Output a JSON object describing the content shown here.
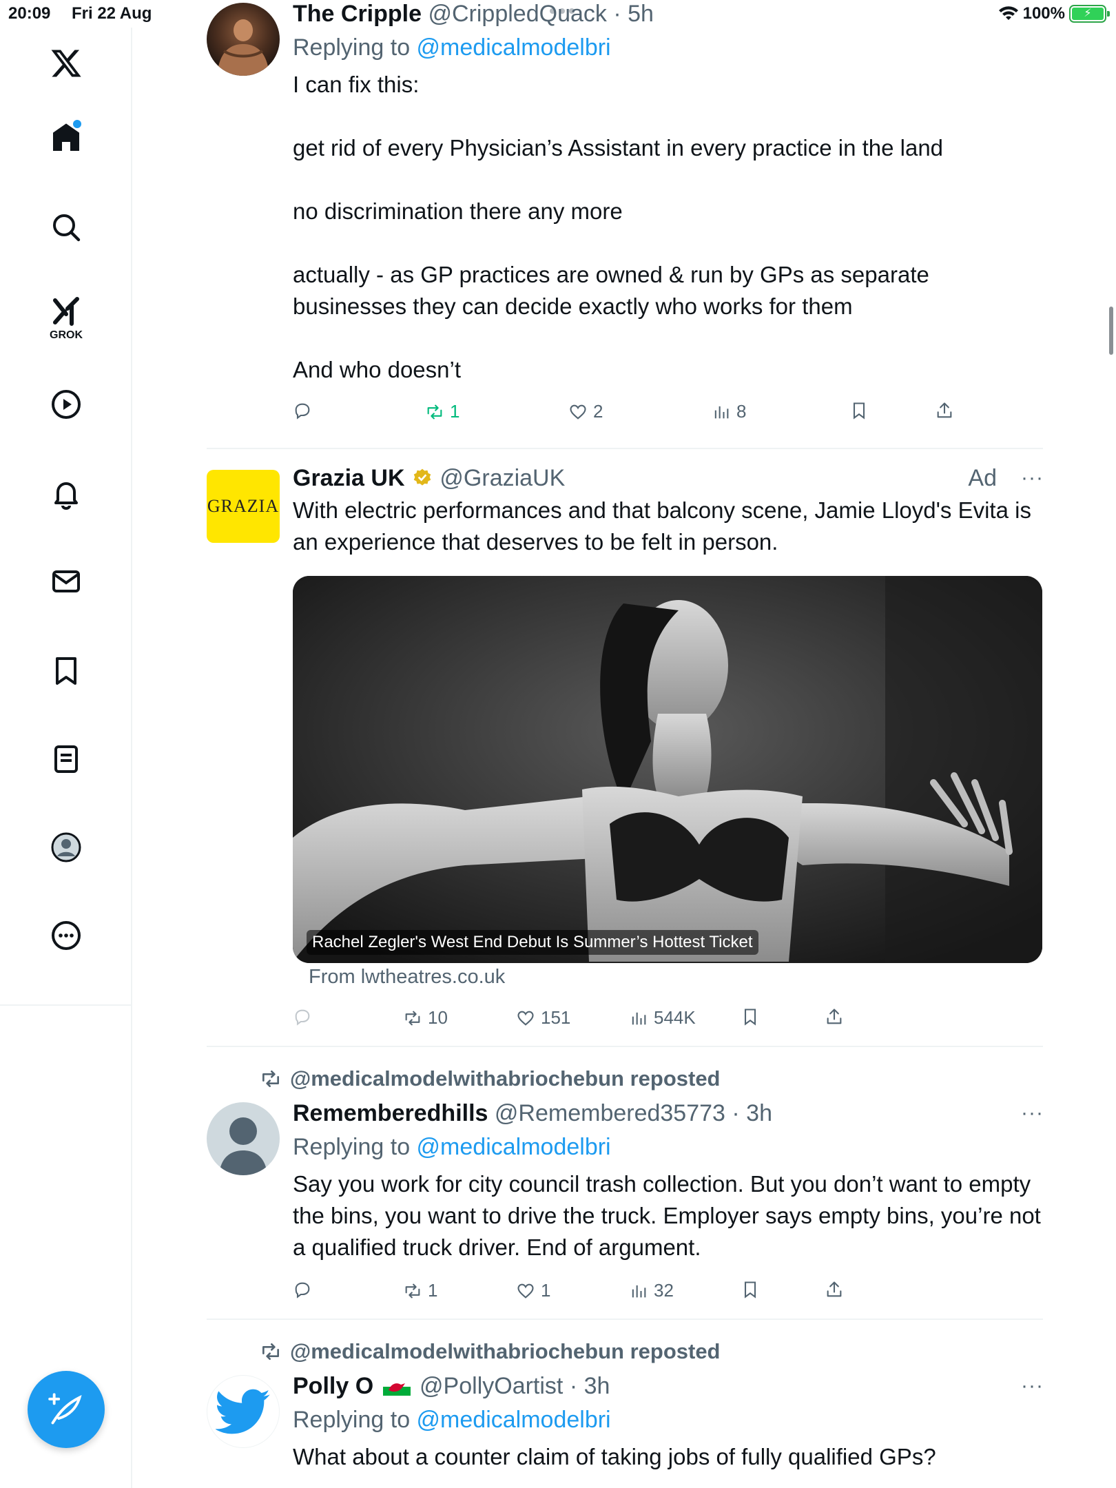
{
  "status_bar": {
    "time": "20:09",
    "date": "Fri 22 Aug",
    "battery": "100%"
  },
  "sidebar": {
    "items": [
      {
        "name": "home"
      },
      {
        "name": "explore"
      },
      {
        "name": "grok",
        "label": "GROK"
      },
      {
        "name": "video"
      },
      {
        "name": "notifications"
      },
      {
        "name": "messages"
      },
      {
        "name": "bookmarks"
      },
      {
        "name": "lists"
      },
      {
        "name": "profile"
      },
      {
        "name": "more"
      }
    ],
    "compose_icon": "compose-feather-icon"
  },
  "tweets": [
    {
      "name": "The Cripple",
      "handle": "@CrippledQuack",
      "time": "· 5h",
      "replying_prefix": "Replying to ",
      "replying_to": "@medicalmodelbri",
      "text": "I can fix this:\n\nget rid of every Physician’s Assistant in every practice in the land\n\nno discrimination there any more\n\nactually - as GP practices are owned & run by GPs as separate businesses they can decide exactly who works for them\n\nAnd who doesn’t",
      "stats": {
        "replies": "",
        "reposts": "1",
        "likes": "2",
        "views": "8"
      }
    },
    {
      "name": "Grazia UK",
      "handle": "@GraziaUK",
      "ad_label": "Ad",
      "avatar_text": "GRAZIA",
      "text": "With electric performances and that balcony scene, Jamie Lloyd's Evita is an experience that deserves to be felt in person.",
      "card_caption": "Rachel Zegler's West End Debut Is Summer’s Hottest Ticket",
      "from": "From lwtheatres.co.uk",
      "stats": {
        "replies": "",
        "reposts": "10",
        "likes": "151",
        "views": "544K"
      }
    },
    {
      "repost_by": "@medicalmodelwithabriochebun reposted",
      "name": "Rememberedhills",
      "handle": "@Remembered35773",
      "time": "· 3h",
      "replying_prefix": "Replying to ",
      "replying_to": "@medicalmodelbri",
      "text": "Say you work for city council trash collection. But you don’t want to empty the bins, you want to drive the truck. Employer says empty bins, you’re not a qualified truck driver. End of argument.",
      "stats": {
        "replies": "",
        "reposts": "1",
        "likes": "1",
        "views": "32"
      }
    },
    {
      "repost_by": "@medicalmodelwithabriochebun reposted",
      "name": "Polly O",
      "flag": "🏴",
      "handle": "@PollyOartist",
      "time": "· 3h",
      "replying_prefix": "Replying to ",
      "replying_to": "@medicalmodelbri",
      "text": "What about a counter claim of taking jobs of fully qualified GPs?"
    }
  ],
  "colors": {
    "accent": "#1d9bf0",
    "muted": "#536471",
    "repost_green": "#00ba7c",
    "grazia_yellow": "#ffe600"
  }
}
